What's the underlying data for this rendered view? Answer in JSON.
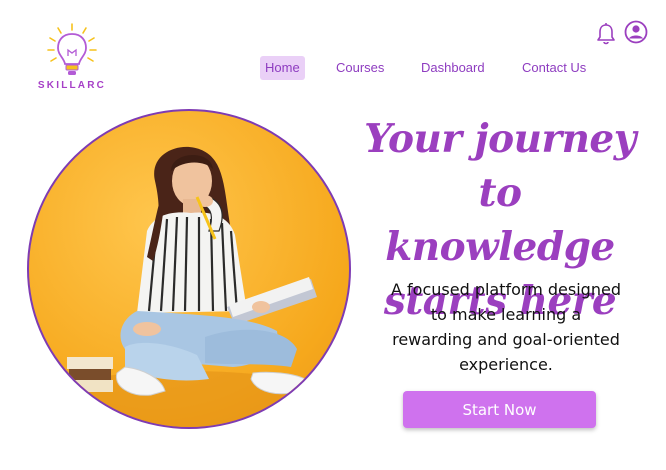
{
  "brand": {
    "name": "SKILLARC",
    "accent": "#a63fc7"
  },
  "header": {
    "icons": {
      "notifications": "bell-icon",
      "account": "user-circle-icon"
    }
  },
  "nav": {
    "items": [
      {
        "label": "Home",
        "active": true
      },
      {
        "label": "Courses",
        "active": false
      },
      {
        "label": "Dashboard",
        "active": false
      },
      {
        "label": "Contact Us",
        "active": false
      }
    ]
  },
  "hero": {
    "headline_lines": [
      "Your journey to",
      "knowledge",
      "starts here"
    ],
    "tagline_lines": [
      "A focused platform designed",
      "to make learning a",
      "rewarding and goal-oriented",
      "experience."
    ],
    "cta_label": "Start Now",
    "headline_color": "#9b3fbf",
    "cta_color": "#cf72ee"
  }
}
